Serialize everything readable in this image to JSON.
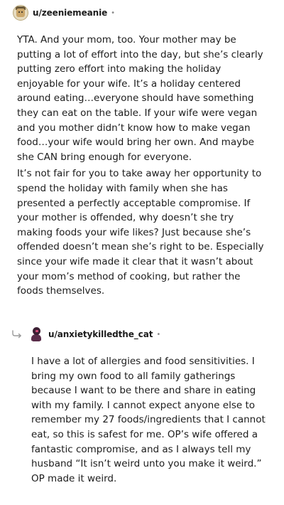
{
  "comments": [
    {
      "author": "u/zeeniemeanie",
      "separator": "•",
      "paragraphs": [
        "YTA. And your mom, too. Your mother may be putting a lot of effort into the day, but she’s clearly putting zero effort into making the holiday enjoyable for your wife. It’s a holiday centered around eating…everyone should have something they can eat on the table. If your wife were vegan and you mother didn’t know how to make vegan food…your wife would bring her own. And maybe she CAN bring enough for everyone.",
        "It’s not fair for you to take away her opportunity to spend the holiday with family when she has presented a perfectly acceptable compromise. If your mother is offended, why doesn’t she try making foods your wife likes? Just because she’s offended doesn’t mean she’s right to be. Especially since your wife made it clear that it wasn’t about your mom’s method of cooking, but rather the foods themselves."
      ]
    },
    {
      "author": "u/anxietykilledthe_cat",
      "separator": "•",
      "paragraphs": [
        "I have a lot of allergies and food sensitivities. I bring my own food to all family gatherings because I want to be there and share in eating with my family. I cannot expect anyone else to remember my 27 foods/ingredients that I cannot eat, so this is safest for me. OP’s wife offered a fantastic compromise, and as I always tell my husband “It isn’t weird unto you make it weird.” OP made it weird."
      ]
    }
  ],
  "icons": {
    "reply": "reply-arrow-icon",
    "avatar1": "user-avatar-icon",
    "avatar2": "user-avatar-icon"
  }
}
